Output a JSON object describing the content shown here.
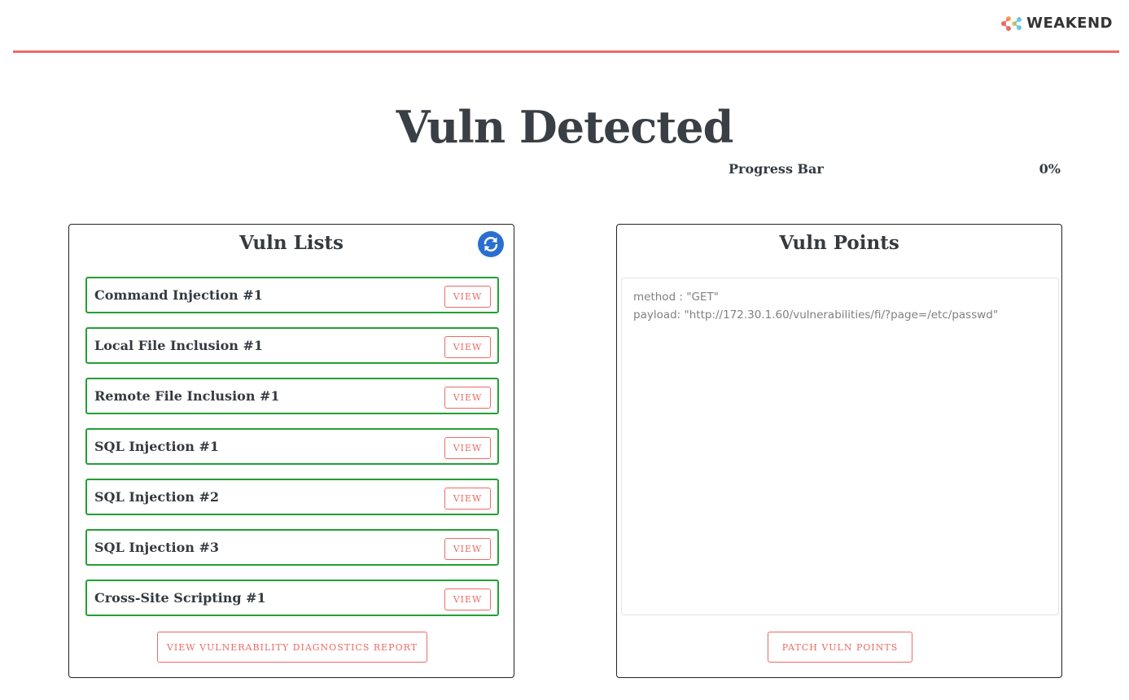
{
  "header": {
    "logo_text": "WEAKEND",
    "accent_color": "#ec6b65"
  },
  "title": "Vuln Detected",
  "progress": {
    "label": "Progress Bar",
    "value_text": "0%",
    "value": 0
  },
  "vuln_lists": {
    "title": "Vuln Lists",
    "refresh_icon": "refresh-icon",
    "items": [
      {
        "label": "Command Injection #1",
        "button": "VIEW"
      },
      {
        "label": "Local File Inclusion #1",
        "button": "VIEW"
      },
      {
        "label": "Remote File Inclusion #1",
        "button": "VIEW"
      },
      {
        "label": "SQL Injection #1",
        "button": "VIEW"
      },
      {
        "label": "SQL Injection #2",
        "button": "VIEW"
      },
      {
        "label": "SQL Injection #3",
        "button": "VIEW"
      },
      {
        "label": "Cross-Site Scripting #1",
        "button": "VIEW"
      }
    ],
    "report_button": "VIEW VULNERABILITY DIAGNOSTICS REPORT"
  },
  "vuln_points": {
    "title": "Vuln Points",
    "lines": [
      "method : \"GET\"",
      "payload: \"http://172.30.1.60/vulnerabilities/fi/?page=/etc/passwd\""
    ],
    "patch_button": "PATCH VULN POINTS"
  }
}
